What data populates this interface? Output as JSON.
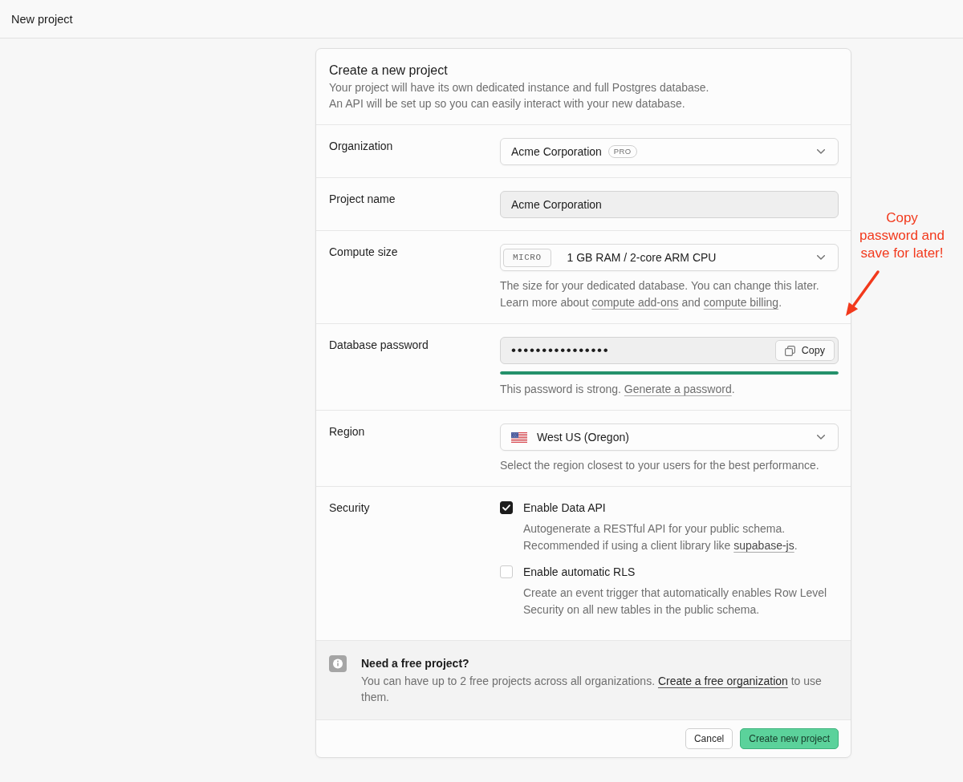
{
  "top_bar": {
    "title": "New project"
  },
  "form": {
    "title": "Create a new project",
    "description": [
      "Your project will have its own dedicated instance and full Postgres database.",
      "An API will be set up so you can easily interact with your new database."
    ],
    "rows": [
      {
        "kind": "org_select",
        "label": "Organization",
        "value": "Acme Corporation",
        "badge": "PRO"
      },
      {
        "kind": "text_input",
        "label": "Project name",
        "value": "Acme Corporation"
      },
      {
        "kind": "compute_select",
        "label": "Compute size",
        "tag": "MICRO",
        "value": "1 GB RAM / 2-core ARM CPU",
        "help": [
          {
            "kind": "text",
            "text": "The size for your dedicated database. You can change this later. Learn more about "
          },
          {
            "kind": "link",
            "text": "compute add-ons"
          },
          {
            "kind": "text",
            "text": " and "
          },
          {
            "kind": "link",
            "text": "compute billing"
          },
          {
            "kind": "text",
            "text": "."
          }
        ]
      },
      {
        "kind": "password",
        "label": "Database password",
        "value": "••••••••••••••••",
        "copy_label": "Copy",
        "strength": {
          "level": 1
        },
        "help": [
          {
            "kind": "text",
            "text": "This password is strong. "
          },
          {
            "kind": "link",
            "text": "Generate a password"
          },
          {
            "kind": "text",
            "text": "."
          }
        ]
      },
      {
        "kind": "region_select",
        "label": "Region",
        "value": "West US (Oregon)",
        "help": [
          {
            "kind": "text",
            "text": "Select the region closest to your users for the best performance."
          }
        ]
      },
      {
        "kind": "checkboxes",
        "label": "Security",
        "options": [
          {
            "label": "Enable Data API",
            "checked": true,
            "description": [
              {
                "kind": "text",
                "text": "Autogenerate a RESTful API for your public schema. Recommended if using a client library like "
              },
              {
                "kind": "link",
                "text": "supabase-js"
              },
              {
                "kind": "text",
                "text": "."
              }
            ]
          },
          {
            "label": "Enable automatic RLS",
            "checked": false,
            "description": [
              {
                "kind": "text",
                "text": "Create an event trigger that automatically enables Row Level Security on all new tables in the public schema."
              }
            ]
          }
        ]
      }
    ],
    "notice": {
      "title": "Need a free project?",
      "text": [
        {
          "kind": "text",
          "text": "You can have up to 2 free projects across all organizations. "
        },
        {
          "kind": "link",
          "text": "Create a free organization"
        },
        {
          "kind": "text",
          "text": " to use them."
        }
      ]
    },
    "buttons": [
      {
        "kind": "cancel",
        "label": "Cancel"
      },
      {
        "kind": "submit",
        "label": "Create new project"
      }
    ]
  },
  "annotation": {
    "text": "Copy password and save for later!"
  }
}
